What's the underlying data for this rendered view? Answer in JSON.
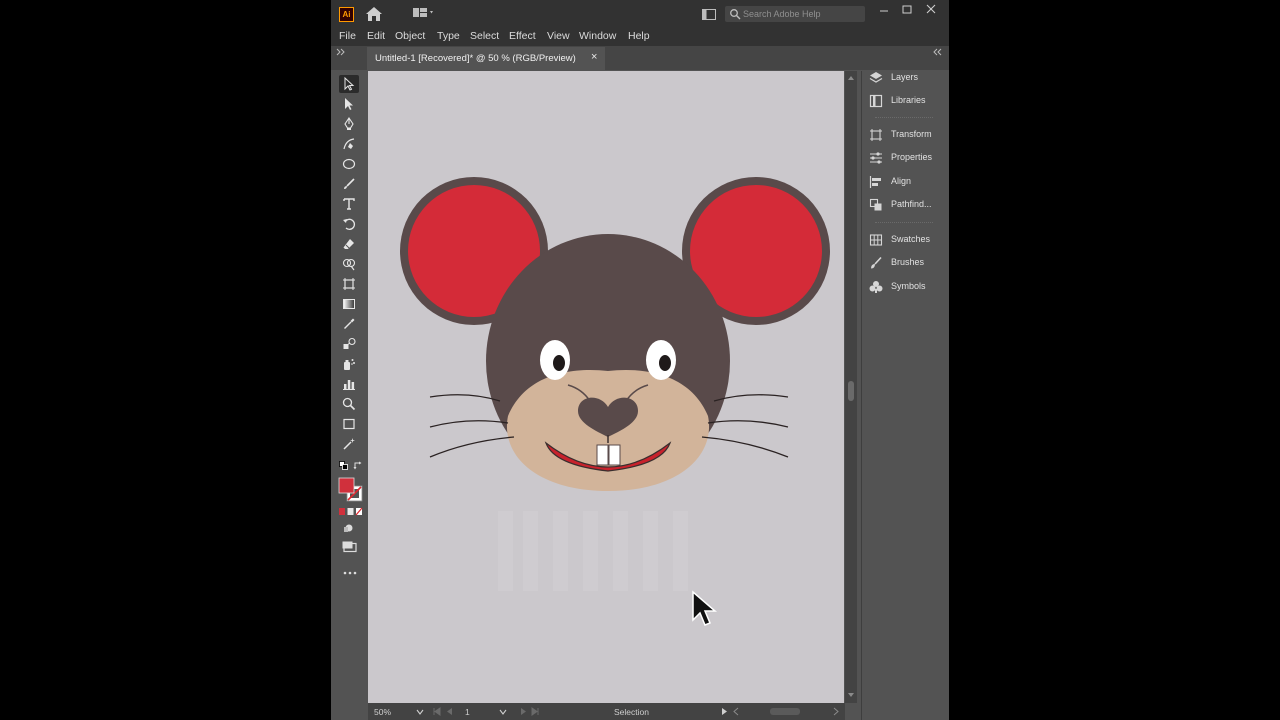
{
  "app": {
    "logo_text": "Ai",
    "search_placeholder": "Search Adobe Help"
  },
  "menu": [
    "File",
    "Edit",
    "Object",
    "Type",
    "Select",
    "Effect",
    "View",
    "Window",
    "Help"
  ],
  "document_tab": {
    "title": "Untitled-1 [Recovered]* @ 50 % (RGB/Preview)",
    "close_glyph": "×"
  },
  "panels": [
    {
      "label": "Layers",
      "icon": "layers-icon"
    },
    {
      "label": "Libraries",
      "icon": "libraries-icon"
    },
    {
      "label": "Transform",
      "icon": "transform-icon"
    },
    {
      "label": "Properties",
      "icon": "properties-icon"
    },
    {
      "label": "Align",
      "icon": "align-icon"
    },
    {
      "label": "Pathfind...",
      "icon": "pathfinder-icon"
    },
    {
      "label": "Swatches",
      "icon": "swatches-icon"
    },
    {
      "label": "Brushes",
      "icon": "brushes-icon"
    },
    {
      "label": "Symbols",
      "icon": "symbols-icon"
    }
  ],
  "status": {
    "zoom": "50%",
    "page": "1",
    "tool": "Selection"
  },
  "colors": {
    "fill": "#d0303c",
    "ear_inner": "#d42b38",
    "head": "#594a4a",
    "muzzle": "#d2b49a",
    "mouth": "#c8222c",
    "canvas": "#cbc8cc"
  }
}
